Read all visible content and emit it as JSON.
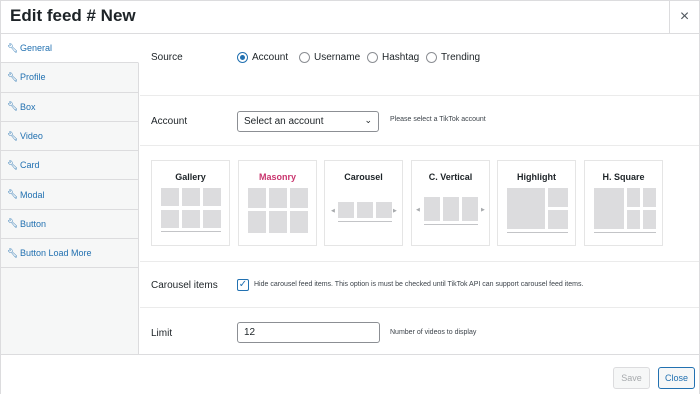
{
  "header": {
    "title": "Edit feed # New",
    "close_glyph": "×"
  },
  "sidebar": {
    "items": [
      {
        "label": "General",
        "icon": "wrench-icon"
      },
      {
        "label": "Profile",
        "icon": "wrench-icon"
      },
      {
        "label": "Box",
        "icon": "wrench-icon"
      },
      {
        "label": "Video",
        "icon": "wrench-icon"
      },
      {
        "label": "Card",
        "icon": "wrench-icon"
      },
      {
        "label": "Modal",
        "icon": "wrench-icon"
      },
      {
        "label": "Button",
        "icon": "wrench-icon"
      },
      {
        "label": "Button Load More",
        "icon": "wrench-icon"
      }
    ],
    "active_index": 0
  },
  "source": {
    "label": "Source",
    "options": [
      "Account",
      "Username",
      "Hashtag",
      "Trending"
    ],
    "selected": "Account"
  },
  "account": {
    "label": "Account",
    "select_value": "Select an account",
    "hint": "Please select a TikTok account"
  },
  "layouts": {
    "cards": [
      {
        "label": "Gallery",
        "selected": false
      },
      {
        "label": "Masonry",
        "selected": true
      },
      {
        "label": "Carousel",
        "selected": false
      },
      {
        "label": "C. Vertical",
        "selected": false
      },
      {
        "label": "Highlight",
        "selected": false
      },
      {
        "label": "H. Square",
        "selected": false
      }
    ],
    "selected_color": "#c9356e"
  },
  "carousel": {
    "label": "Carousel items",
    "checked": true,
    "description": "Hide carousel feed items. This option is must be checked until TikTok API can support carousel feed items."
  },
  "limit": {
    "label": "Limit",
    "value": "12",
    "hint": "Number of videos to display"
  },
  "footer": {
    "save_label": "Save",
    "close_label": "Close"
  },
  "colors": {
    "accent": "#2271b1",
    "border": "#dcdcde"
  }
}
